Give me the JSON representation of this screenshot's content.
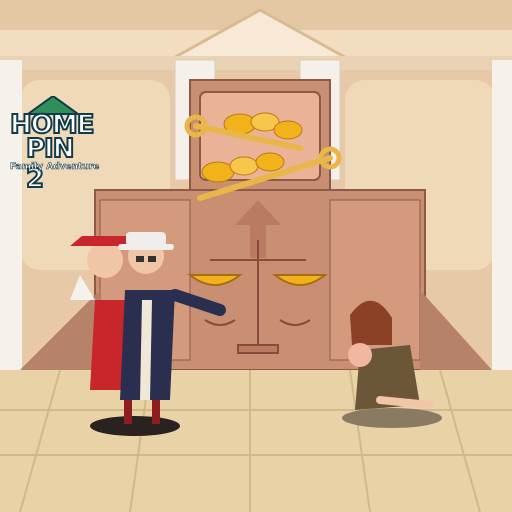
{
  "logo": {
    "line1": "HOME",
    "line2": "PIN 2",
    "tagline": "Family Adventure"
  },
  "scene": {
    "setting": "courtroom",
    "elements": [
      "gold-coins",
      "pull-pins",
      "justice-scales",
      "rich-couple",
      "kneeling-mother-with-baby"
    ]
  },
  "colors": {
    "wall": "#c98f72",
    "floor": "#e8d2a6",
    "gold": "#f2b21b",
    "pin": "#e9b64a"
  }
}
